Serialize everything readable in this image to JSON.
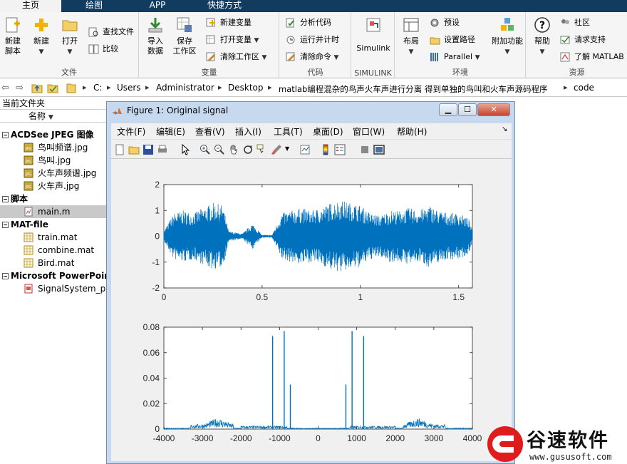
{
  "tabs": [
    "主页",
    "绘图",
    "APP",
    "快捷方式"
  ],
  "ribbon": {
    "file": {
      "label": "文件",
      "new_script": "新建\n脚本",
      "new": "新建",
      "open": "打开",
      "find_files": "查找文件",
      "compare": "比较"
    },
    "variable": {
      "label": "变量",
      "import": "导入\n数据",
      "save_ws": "保存\n工作区",
      "new_var": "新建变量",
      "open_var": "打开变量",
      "clear_ws": "清除工作区"
    },
    "code": {
      "label": "代码",
      "analyze": "分析代码",
      "run_time": "运行并计时",
      "clear_cmd": "清除命令"
    },
    "simulink": {
      "label": "SIMULINK",
      "simulink": "Simulink"
    },
    "env": {
      "label": "环境",
      "layout": "布局",
      "prefs": "预设",
      "set_path": "设置路径",
      "parallel": "Parallel",
      "addons": "附加功能"
    },
    "resources": {
      "label": "资源",
      "help": "帮助",
      "community": "社区",
      "support": "请求支持",
      "learn": "了解 MATLAB"
    }
  },
  "address": [
    "C:",
    "Users",
    "Administrator",
    "Desktop",
    "matlab编程混杂的鸟声火车声进行分离 得到单独的鸟叫和火车声源码程序",
    "code"
  ],
  "current_folder": {
    "title": "当前文件夹",
    "col_name": "名称",
    "groups": [
      {
        "name": "ACDSee JPEG 图像",
        "files": [
          "鸟叫频谱.jpg",
          "鸟叫.jpg",
          "火车声频谱.jpg",
          "火车声.jpg"
        ]
      },
      {
        "name": "脚本",
        "files": [
          "main.m"
        ]
      },
      {
        "name": "MAT-file",
        "files": [
          "train.mat",
          "combine.mat",
          "Bird.mat"
        ]
      },
      {
        "name": "Microsoft PowerPoint",
        "files": [
          "SignalSystem_pr"
        ]
      }
    ]
  },
  "figure": {
    "title": "Figure 1: Original signal",
    "menus": [
      "文件(F)",
      "编辑(E)",
      "查看(V)",
      "插入(I)",
      "工具(T)",
      "桌面(D)",
      "窗口(W)",
      "帮助(H)"
    ]
  },
  "chart_data": [
    {
      "type": "line",
      "title": "",
      "xlabel": "",
      "ylabel": "",
      "xlim": [
        0,
        1.57
      ],
      "ylim": [
        -2,
        2
      ],
      "xticks": [
        0,
        0.5,
        1,
        1.5
      ],
      "yticks": [
        -2,
        -1,
        0,
        1,
        2
      ],
      "color": "#0072bd",
      "envelope": {
        "x": [
          0,
          0.05,
          0.1,
          0.15,
          0.2,
          0.25,
          0.3,
          0.33,
          0.4,
          0.45,
          0.5,
          0.55,
          0.6,
          0.65,
          0.7,
          0.75,
          0.8,
          0.85,
          0.9,
          0.95,
          1,
          1.05,
          1.1,
          1.15,
          1.2,
          1.25,
          1.3,
          1.35,
          1.4,
          1.45,
          1.5,
          1.55,
          1.57
        ],
        "amp": [
          0.2,
          0.9,
          1.0,
          0.9,
          1.1,
          1.3,
          1.2,
          0.2,
          0.1,
          0.5,
          0.05,
          0.05,
          0.9,
          1.0,
          1.1,
          1.0,
          1.1,
          1.3,
          1.4,
          1.3,
          1.2,
          0.9,
          0.8,
          1.0,
          1.0,
          1.1,
          1.0,
          1.2,
          1.0,
          0.9,
          0.9,
          0.7,
          0.2
        ]
      }
    },
    {
      "type": "line",
      "title": "",
      "xlabel": "",
      "ylabel": "",
      "xlim": [
        -4000,
        4000
      ],
      "ylim": [
        0,
        0.08
      ],
      "xticks": [
        -4000,
        -3000,
        -2000,
        -1000,
        0,
        1000,
        2000,
        3000,
        4000
      ],
      "yticks": [
        0,
        0.02,
        0.04,
        0.06,
        0.08
      ],
      "color": "#0072bd",
      "peaks": [
        {
          "x": -1180,
          "y": 0.073
        },
        {
          "x": -880,
          "y": 0.077
        },
        {
          "x": -720,
          "y": 0.035
        },
        {
          "x": 720,
          "y": 0.035
        },
        {
          "x": 880,
          "y": 0.077
        },
        {
          "x": 1180,
          "y": 0.073
        }
      ]
    }
  ],
  "watermark": {
    "brand": "谷速软件",
    "url": "www.gususoft.com"
  }
}
